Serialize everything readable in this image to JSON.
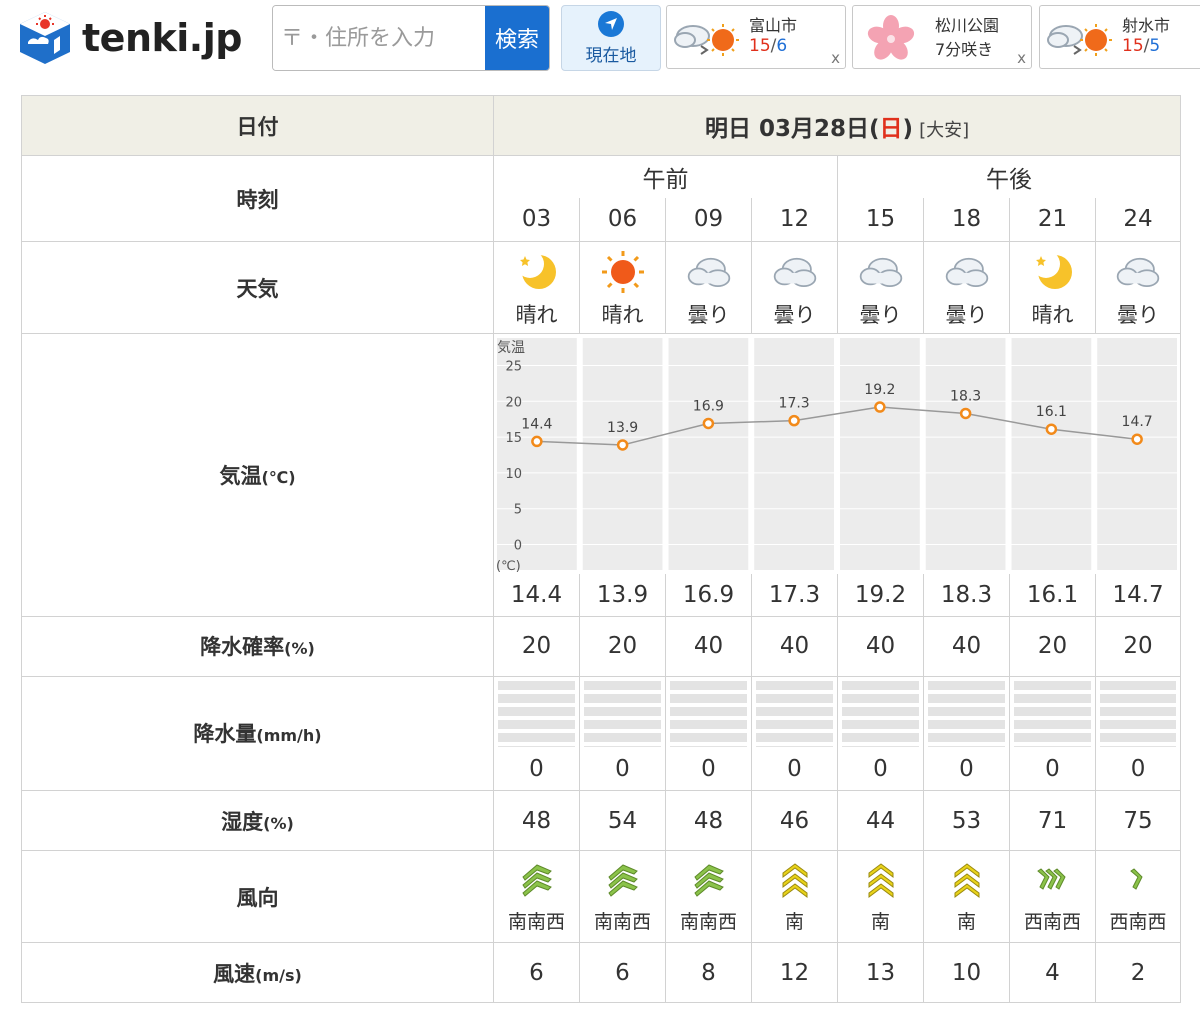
{
  "header": {
    "logo_text": "tenki.jp",
    "search_placeholder": "〒・住所を入力",
    "search_button": "検索",
    "location_button": "現在地",
    "history": [
      {
        "name": "富山市",
        "high": "15",
        "sep": "/",
        "low": "6",
        "close": "x",
        "icon": "cloud-then-sun-icon"
      },
      {
        "name": "松川公園",
        "sub": "7分咲き",
        "close": "x",
        "icon": "cherry-blossom-icon"
      },
      {
        "name": "射水市",
        "high": "15",
        "sep": "/",
        "low": "5",
        "icon": "cloud-then-sun-icon"
      }
    ]
  },
  "forecast": {
    "labels": {
      "date": "日付",
      "time": "時刻",
      "weather": "天気",
      "temp": "気温",
      "temp_unit": "(℃)",
      "precip_prob": "降水確率",
      "precip_prob_unit": "(%)",
      "precip_amount": "降水量",
      "precip_amount_unit": "(mm/h)",
      "humidity": "湿度",
      "humidity_unit": "(%)",
      "wind_dir": "風向",
      "wind_speed": "風速",
      "wind_speed_unit": "(m/s)"
    },
    "date_prefix": "明日 03月28日(",
    "date_day": "日",
    "date_suffix": ")",
    "rokuyo": "[大安]",
    "am": "午前",
    "pm": "午後",
    "hours": [
      "03",
      "06",
      "09",
      "12",
      "15",
      "18",
      "21",
      "24"
    ],
    "weather": [
      {
        "icon": "moon-icon",
        "text": "晴れ"
      },
      {
        "icon": "sun-icon",
        "text": "晴れ"
      },
      {
        "icon": "cloud-icon",
        "text": "曇り"
      },
      {
        "icon": "cloud-icon",
        "text": "曇り"
      },
      {
        "icon": "cloud-icon",
        "text": "曇り"
      },
      {
        "icon": "cloud-icon",
        "text": "曇り"
      },
      {
        "icon": "moon-icon",
        "text": "晴れ"
      },
      {
        "icon": "cloud-icon",
        "text": "曇り"
      }
    ],
    "temps_text": [
      "14.4",
      "13.9",
      "16.9",
      "17.3",
      "19.2",
      "18.3",
      "16.1",
      "14.7"
    ],
    "precip_prob": [
      "20",
      "20",
      "40",
      "40",
      "40",
      "40",
      "20",
      "20"
    ],
    "precip_amount": [
      "0",
      "0",
      "0",
      "0",
      "0",
      "0",
      "0",
      "0"
    ],
    "humidity": [
      "48",
      "54",
      "48",
      "46",
      "44",
      "53",
      "71",
      "75"
    ],
    "wind_dir": [
      {
        "icon": "wind-ssw-icon",
        "text": "南南西",
        "color": "#8bc34a"
      },
      {
        "icon": "wind-ssw-icon",
        "text": "南南西",
        "color": "#8bc34a"
      },
      {
        "icon": "wind-ssw-icon",
        "text": "南南西",
        "color": "#8bc34a"
      },
      {
        "icon": "wind-s-icon",
        "text": "南",
        "color": "#e8d21a"
      },
      {
        "icon": "wind-s-icon",
        "text": "南",
        "color": "#e8d21a"
      },
      {
        "icon": "wind-s-icon",
        "text": "南",
        "color": "#e8d21a"
      },
      {
        "icon": "wind-wsw-icon",
        "text": "西南西",
        "color": "#8bc34a"
      },
      {
        "icon": "wind-wsw-icon",
        "text": "西南西",
        "color": "#8bc34a"
      }
    ],
    "wind_speed": [
      "6",
      "6",
      "8",
      "12",
      "13",
      "10",
      "4",
      "2"
    ]
  },
  "chart_data": {
    "type": "line",
    "title": "気温",
    "unit_label": "(℃)",
    "x": [
      "03",
      "06",
      "09",
      "12",
      "15",
      "18",
      "21",
      "24"
    ],
    "values": [
      14.4,
      13.9,
      16.9,
      17.3,
      19.2,
      18.3,
      16.1,
      14.7
    ],
    "y_ticks": [
      25,
      20,
      15,
      10,
      5,
      0
    ],
    "ylim": [
      -3,
      28
    ],
    "grid": true,
    "point_color": "#f28a1a",
    "line_color": "#999999"
  }
}
